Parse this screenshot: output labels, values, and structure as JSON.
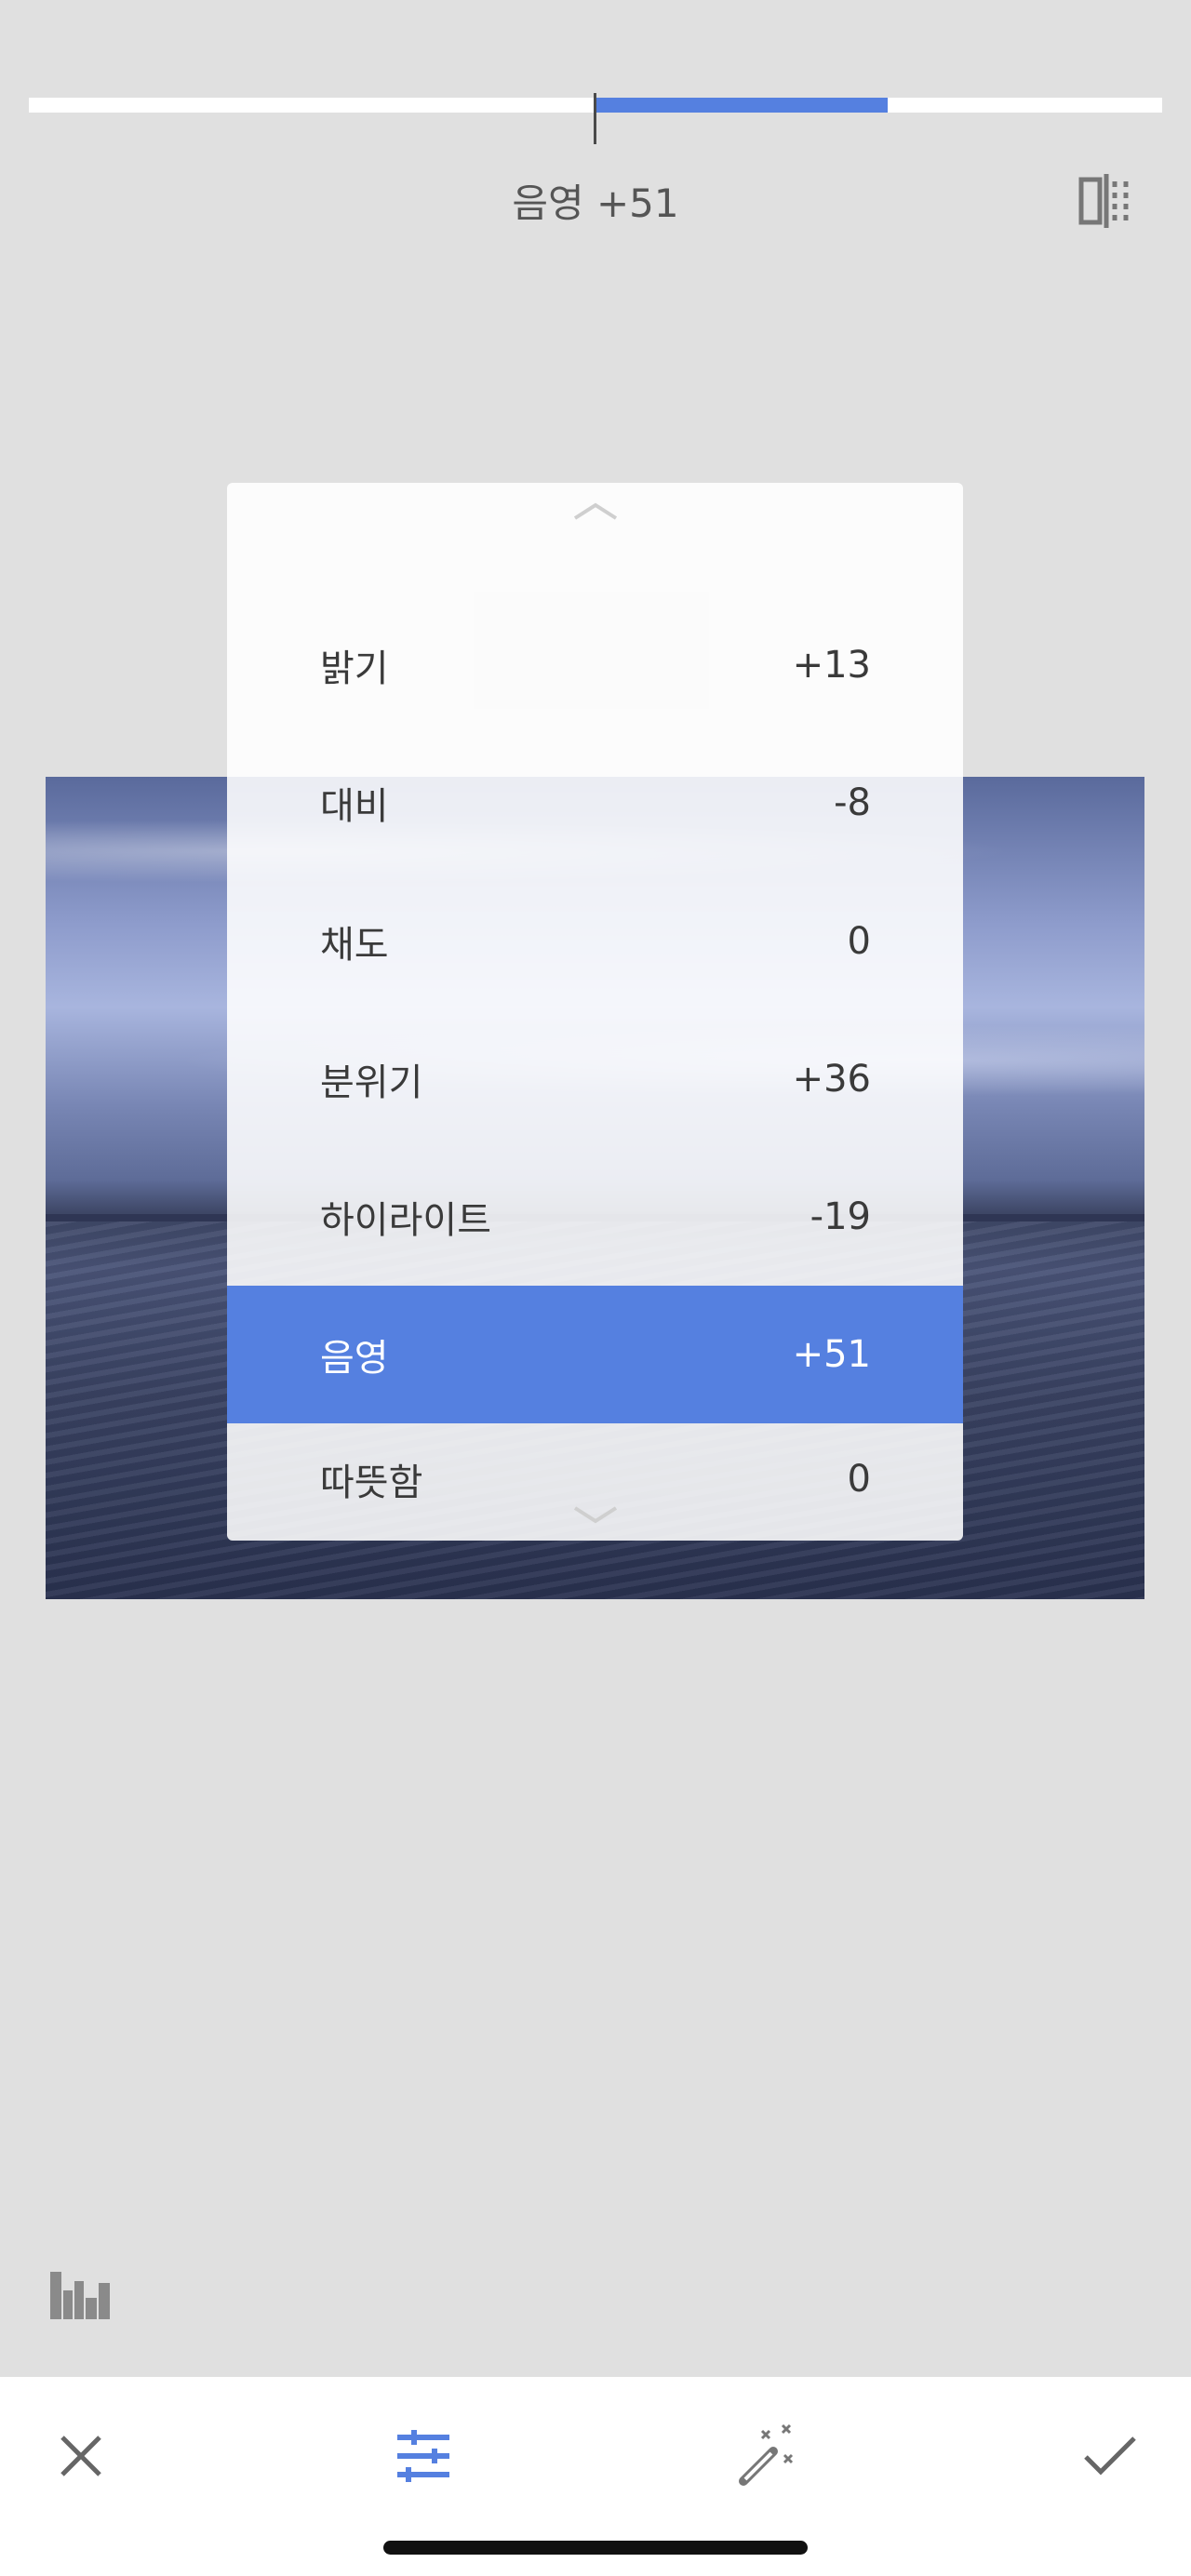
{
  "editor": {
    "current_param_label": "음영 +51",
    "slider_value": 51
  },
  "adjustments": [
    {
      "label": "밝기",
      "value": "+13"
    },
    {
      "label": "대비",
      "value": "-8"
    },
    {
      "label": "채도",
      "value": "0"
    },
    {
      "label": "분위기",
      "value": "+36"
    },
    {
      "label": "하이라이트",
      "value": "-19"
    },
    {
      "label": "음영",
      "value": "+51",
      "selected": true
    },
    {
      "label": "따뜻함",
      "value": "0"
    }
  ],
  "icons": {
    "compare": "compare-icon",
    "histogram": "histogram-icon",
    "cancel": "close-icon",
    "adjust": "sliders-icon",
    "auto": "magic-wand-icon",
    "apply": "checkmark-icon",
    "scroll_up": "chevron-up-icon",
    "scroll_down": "chevron-down-icon"
  },
  "colors": {
    "accent": "#5580e0",
    "background": "#e0e0e0"
  }
}
